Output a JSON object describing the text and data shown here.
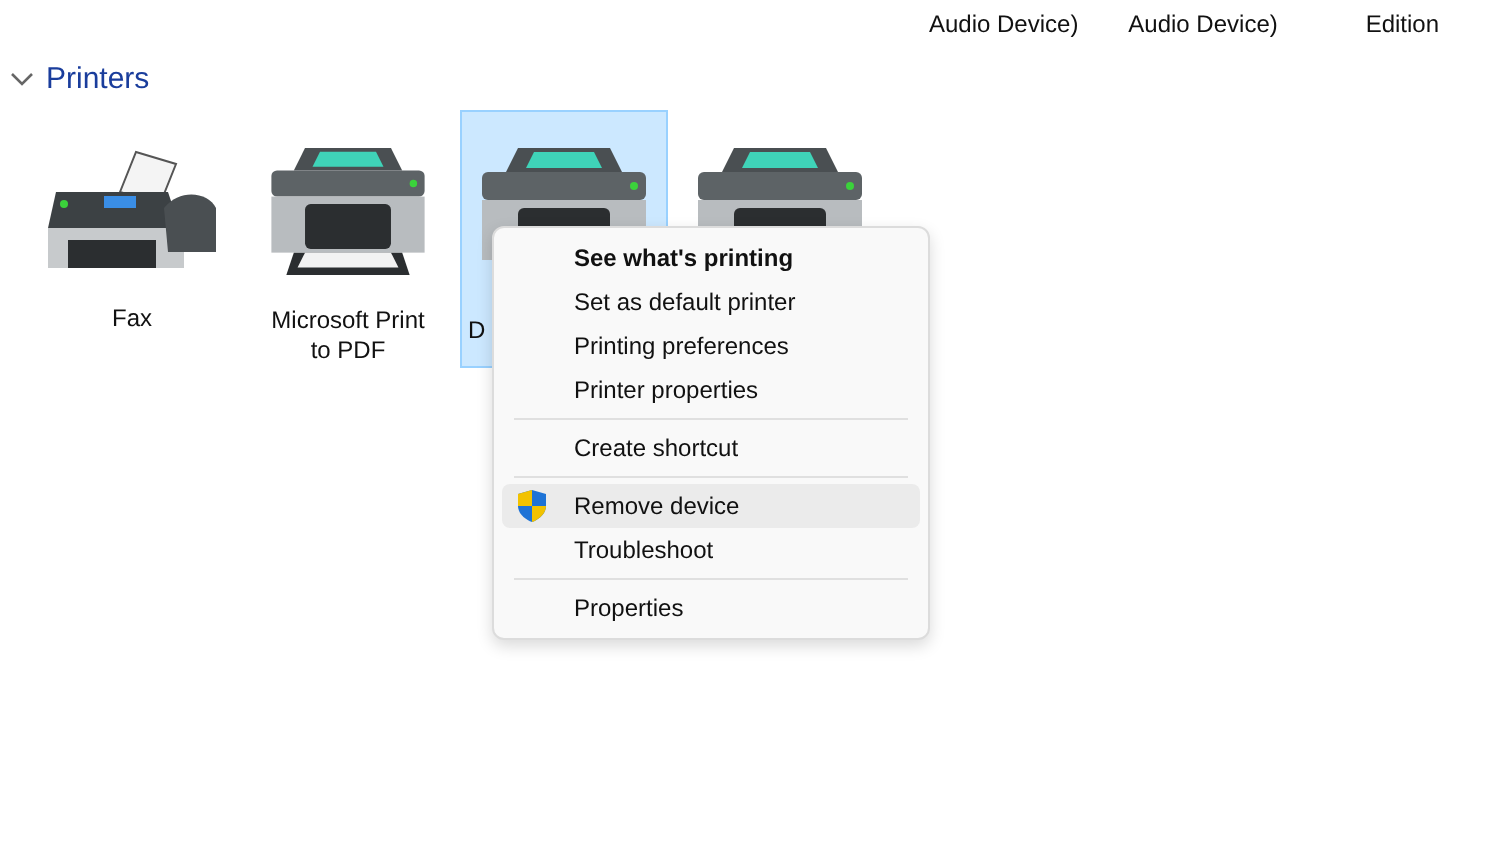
{
  "top_labels": [
    "Audio Device)",
    "Audio Device)",
    "Edition"
  ],
  "section": {
    "title": "Printers",
    "expanded": true
  },
  "devices": [
    {
      "kind": "fax",
      "label": "Fax",
      "selected": false
    },
    {
      "kind": "printer",
      "label": "Microsoft Print to PDF",
      "selected": false
    },
    {
      "kind": "printer",
      "label": "D",
      "selected": true,
      "covered": true
    },
    {
      "kind": "printer",
      "selected": false
    }
  ],
  "context_menu": {
    "groups": [
      [
        {
          "kind": "plain",
          "label": "See what's printing",
          "bold": true,
          "highlighted": false
        },
        {
          "kind": "plain",
          "label": "Set as default printer",
          "bold": false,
          "highlighted": false
        },
        {
          "kind": "plain",
          "label": "Printing preferences",
          "bold": false,
          "highlighted": false
        },
        {
          "kind": "plain",
          "label": "Printer properties",
          "bold": false,
          "highlighted": false
        }
      ],
      [
        {
          "kind": "plain",
          "label": "Create shortcut",
          "bold": false,
          "highlighted": false
        }
      ],
      [
        {
          "kind": "admin",
          "label": "Remove device",
          "bold": false,
          "highlighted": true
        },
        {
          "kind": "plain",
          "label": "Troubleshoot",
          "bold": false,
          "highlighted": false
        }
      ],
      [
        {
          "kind": "plain",
          "label": "Properties",
          "bold": false,
          "highlighted": false
        }
      ]
    ]
  }
}
